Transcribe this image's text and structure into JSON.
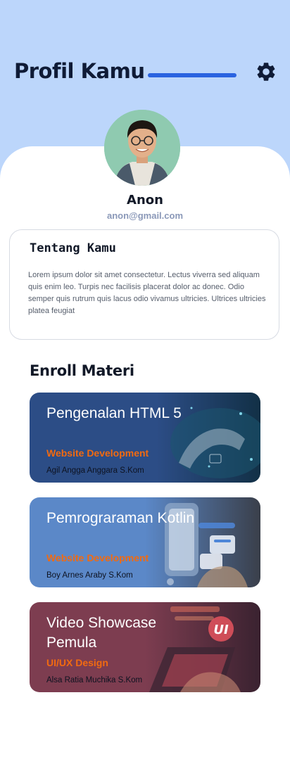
{
  "header": {
    "title": "Profil Kamu",
    "settings_icon": "gear-icon",
    "accent": "#2a63e0",
    "background": "#bcd6fb"
  },
  "profile": {
    "name": "Anon",
    "email": "anon@gmail.com"
  },
  "about": {
    "title": "Tentang Kamu",
    "text": "Lorem ipsum dolor sit amet consectetur. Lectus viverra sed aliquam quis enim leo. Turpis nec facilisis placerat dolor ac donec. Odio semper quis rutrum quis lacus odio vivamus ultricies. Ultrices ultricies platea feugiat"
  },
  "enroll": {
    "title": "Enroll Materi",
    "courses": [
      {
        "title": "Pengenalan HTML 5",
        "category": "Website Development",
        "mentor": "Agil Angga Anggara S.Kom",
        "color": "#2c4d86"
      },
      {
        "title": "Pemrograraman Kotlin",
        "category": "Website Development",
        "mentor": "Boy Arnes Araby S.Kom",
        "color": "#5b88c8"
      },
      {
        "title": "Video Showcase Pemula",
        "category": "UI/UX Design",
        "mentor": "Alsa Ratia Muchika S.Kom",
        "color": "#7d3d50"
      }
    ]
  }
}
